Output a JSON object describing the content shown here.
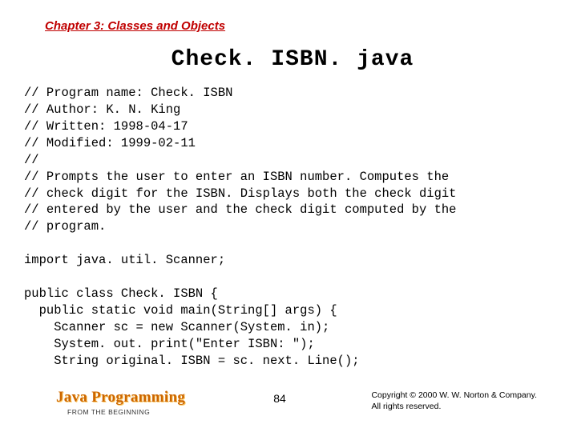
{
  "chapter": "Chapter 3: Classes and Objects",
  "title": "Check. ISBN. java",
  "code_lines": [
    "// Program name: Check. ISBN",
    "// Author: K. N. King",
    "// Written: 1998-04-17",
    "// Modified: 1999-02-11",
    "//",
    "// Prompts the user to enter an ISBN number. Computes the",
    "// check digit for the ISBN. Displays both the check digit",
    "// entered by the user and the check digit computed by the",
    "// program.",
    "",
    "import java. util. Scanner;",
    "",
    "public class Check. ISBN {",
    "  public static void main(String[] args) {",
    "    Scanner sc = new Scanner(System. in);",
    "    System. out. print(\"Enter ISBN: \");",
    "    String original. ISBN = sc. next. Line();"
  ],
  "footer": {
    "brand": "Java Programming",
    "subbrand": "FROM THE BEGINNING",
    "page": "84",
    "copyright_line1": "Copyright © 2000 W. W. Norton & Company.",
    "copyright_line2": "All rights reserved."
  }
}
